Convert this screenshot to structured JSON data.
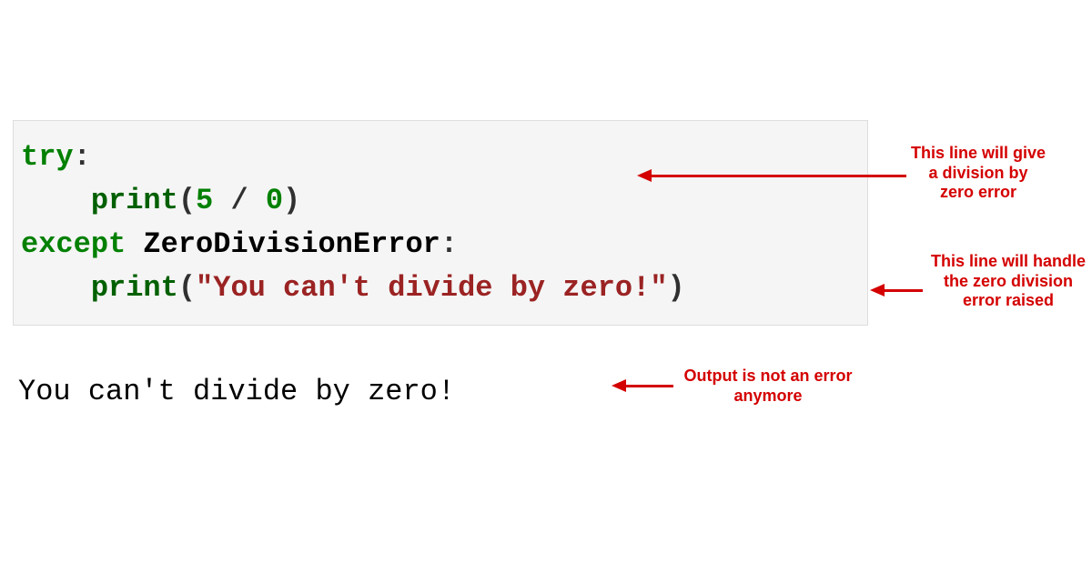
{
  "code": {
    "line1_try": "try",
    "line1_colon": ":",
    "line2_indent": "    ",
    "line2_print": "print",
    "line2_open": "(",
    "line2_n1": "5",
    "line2_op": " / ",
    "line2_n2": "0",
    "line2_close": ")",
    "line3_except": "except",
    "line3_space": " ",
    "line3_err": "ZeroDivisionError",
    "line3_colon": ":",
    "line4_indent": "    ",
    "line4_print": "print",
    "line4_open": "(",
    "line4_str": "\"You can't divide by zero!\"",
    "line4_close": ")"
  },
  "output": "You can't divide by zero!",
  "annotations": {
    "anno1": "This line will give a division by zero error",
    "anno2": "This line will handle the zero division error raised",
    "anno3": "Output is not an error anymore"
  }
}
